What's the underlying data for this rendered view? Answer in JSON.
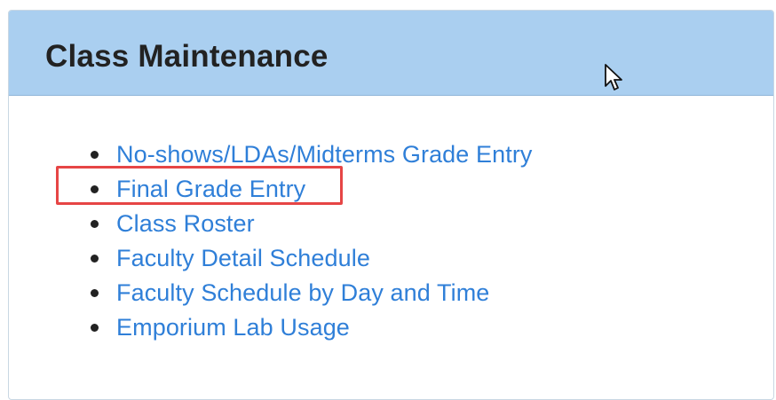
{
  "panel": {
    "title": "Class Maintenance",
    "links": [
      {
        "label": "No-shows/LDAs/Midterms Grade Entry"
      },
      {
        "label": "Final Grade Entry"
      },
      {
        "label": "Class Roster"
      },
      {
        "label": "Faculty Detail Schedule"
      },
      {
        "label": "Faculty Schedule by Day and Time"
      },
      {
        "label": "Emporium Lab Usage"
      }
    ]
  },
  "colors": {
    "header_background": "#aacff0",
    "link": "#2f7fd8",
    "highlight": "#e64545"
  },
  "icons": {
    "cursor": "mouse-pointer-icon"
  }
}
